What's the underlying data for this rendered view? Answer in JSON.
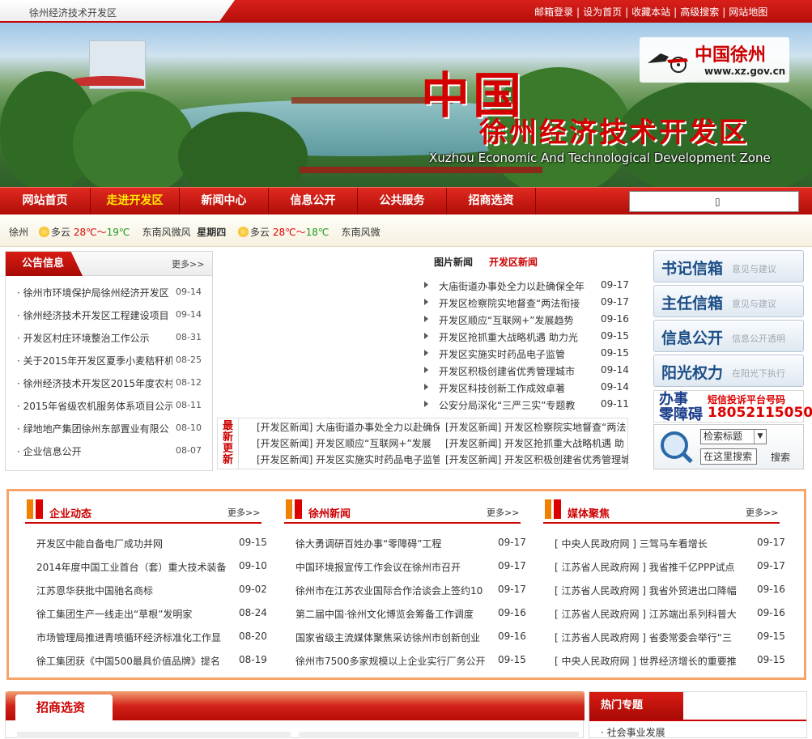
{
  "topbar": {
    "site_name": "徐州经济技术开发区",
    "links": [
      "邮箱登录",
      "设为首页",
      "收藏本站",
      "高级搜索",
      "网站地图"
    ]
  },
  "banner": {
    "title_big": "中国",
    "title_sub": "徐州经济技术开发区",
    "title_en": "Xuzhou Economic And Technological Development Zone",
    "logo_text": "中国徐州",
    "logo_url": "www.xz.gov.cn"
  },
  "nav": {
    "items": [
      "网站首页",
      "走进开发区",
      "新闻中心",
      "信息公开",
      "公共服务",
      "招商选资"
    ],
    "active_index": 1,
    "search_glyph": "▯"
  },
  "weather": {
    "city": "徐州",
    "day1": {
      "cond": "多云",
      "hi": "28℃",
      "sep": "～",
      "lo": "19℃",
      "wind": "东南风微风"
    },
    "weekday": "星期四",
    "day2": {
      "cond": "多云",
      "hi": "28℃",
      "sep": "～",
      "lo": "18℃",
      "wind": "东南风微"
    }
  },
  "notice": {
    "title": "公告信息",
    "more": "更多>>",
    "items": [
      {
        "title": "徐州市环境保护局徐州经济开发区",
        "date": "09-14"
      },
      {
        "title": "徐州经济技术开发区工程建设项目",
        "date": "09-14"
      },
      {
        "title": "开发区村庄环境整治工作公示",
        "date": "08-31"
      },
      {
        "title": "关于2015年开发区夏季小麦秸秆机",
        "date": "08-25"
      },
      {
        "title": "徐州经济技术开发区2015年度农村",
        "date": "08-12"
      },
      {
        "title": "2015年省级农机服务体系项目公示",
        "date": "08-11"
      },
      {
        "title": "绿地地产集团徐州东部置业有限公",
        "date": "08-10"
      },
      {
        "title": "企业信息公开",
        "date": "08-07"
      }
    ]
  },
  "picnews": {
    "tab1": "图片新闻",
    "tab2": "开发区新闻",
    "items": [
      {
        "title": "大庙街道办事处全力以赴确保全年",
        "date": "09-17"
      },
      {
        "title": "开发区检察院实地督查“两法衔接",
        "date": "09-17"
      },
      {
        "title": "开发区顺应“互联网+”发展趋势",
        "date": "09-16"
      },
      {
        "title": "开发区抢抓重大战略机遇 助力光",
        "date": "09-15"
      },
      {
        "title": "开发区实施实时药品电子监管",
        "date": "09-15"
      },
      {
        "title": "开发区积极创建省优秀管理城市",
        "date": "09-14"
      },
      {
        "title": "开发区科技创新工作成效卓著",
        "date": "09-14"
      },
      {
        "title": "公安分局深化“三严三实”专题教",
        "date": "09-11"
      }
    ]
  },
  "latest": {
    "label": "最新更新",
    "rows": [
      [
        "[开发区新闻] 大庙街道办事处全力以赴确保",
        "[开发区新闻] 开发区检察院实地督查“两法"
      ],
      [
        "[开发区新闻] 开发区顺应“互联网+”发展",
        "[开发区新闻] 开发区抢抓重大战略机遇 助"
      ],
      [
        "[开发区新闻] 开发区实施实时药品电子监管",
        "[开发区新闻] 开发区积极创建省优秀管理城"
      ]
    ]
  },
  "right": {
    "buttons": [
      {
        "big": "书记信箱",
        "small": "意见与建议"
      },
      {
        "big": "主任信箱",
        "small": "意见与建议"
      },
      {
        "big": "信息公开",
        "small": "信息公开透明"
      },
      {
        "big": "阳光权力",
        "small": "在阳光下执行"
      }
    ],
    "complain_a": "办事",
    "complain_a2": "零障碍",
    "complain_b": "短信投诉平台号码",
    "complain_c": "18052115050",
    "search_select": "检索标题",
    "search_input": "在这里搜索",
    "search_button": "搜索"
  },
  "columns": [
    {
      "title": "企业动态",
      "more": "更多>>",
      "items": [
        {
          "title": "开发区中能自备电厂成功并网",
          "date": "09-15"
        },
        {
          "title": "2014年度中国工业首台（套）重大技术装备",
          "date": "09-10"
        },
        {
          "title": "江苏恩华获批中国驰名商标",
          "date": "09-02"
        },
        {
          "title": "徐工集团生产一线走出“草根”发明家",
          "date": "08-24"
        },
        {
          "title": "市场管理局推进青喷循环经济标准化工作显",
          "date": "08-20"
        },
        {
          "title": "徐工集团获《中国500最具价值品牌》提名",
          "date": "08-19"
        }
      ]
    },
    {
      "title": "徐州新闻",
      "more": "更多>>",
      "items": [
        {
          "title": "徐大勇调研百姓办事“零障碍”工程",
          "date": "09-17"
        },
        {
          "title": "中国环境报宣传工作会议在徐州市召开",
          "date": "09-17"
        },
        {
          "title": "徐州市在江苏农业国际合作洽谈会上签约10",
          "date": "09-17"
        },
        {
          "title": "第二届中国·徐州文化博览会筹备工作调度",
          "date": "09-16"
        },
        {
          "title": "国家省级主流媒体聚焦采访徐州市创新创业",
          "date": "09-16"
        },
        {
          "title": "徐州市7500多家规模以上企业实行厂务公开",
          "date": "09-15"
        }
      ]
    },
    {
      "title": "媒体聚焦",
      "more": "更多>>",
      "items": [
        {
          "title": "[ 中央人民政府网 ] 三驾马车看增长",
          "date": "09-17"
        },
        {
          "title": "[ 江苏省人民政府网 ] 我省推千亿PPP试点",
          "date": "09-17"
        },
        {
          "title": "[ 江苏省人民政府网 ] 我省外贸进出口降幅",
          "date": "09-16"
        },
        {
          "title": "[ 江苏省人民政府网 ] 江苏端出系列科普大",
          "date": "09-16"
        },
        {
          "title": "[ 江苏省人民政府网 ] 省委常委会举行“三",
          "date": "09-15"
        },
        {
          "title": "[ 中央人民政府网 ] 世界经济增长的重要推",
          "date": "09-15"
        }
      ]
    }
  ],
  "zhaoshang": {
    "title": "招商选资"
  },
  "hot": {
    "title": "热门专题",
    "first_item": "社会事业发展"
  }
}
